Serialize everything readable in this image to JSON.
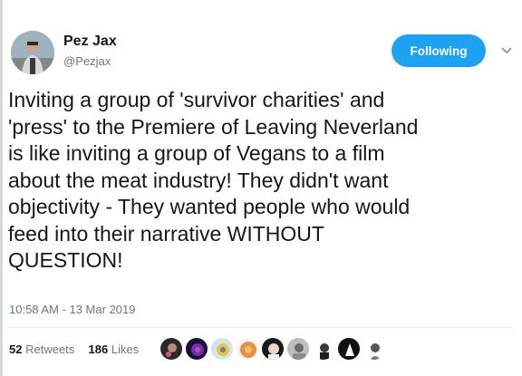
{
  "user": {
    "display_name": "Pez Jax",
    "handle": "@Pezjax"
  },
  "follow_button": {
    "label": "Following"
  },
  "tweet": {
    "text_lines": [
      "Inviting a group of 'survivor charities' and",
      "'press' to the Premiere of Leaving Neverland",
      "is like inviting a group of Vegans to a film",
      "about the meat industry! They didn't want",
      "objectivity - They wanted people who would",
      "feed into their narrative WITHOUT",
      "QUESTION!"
    ],
    "timestamp": "10:58 AM - 13 Mar 2019"
  },
  "stats": {
    "retweets_count": "52",
    "retweets_label": "Retweets",
    "likes_count": "186",
    "likes_label": "Likes"
  },
  "colors": {
    "accent": "#1da1f2",
    "text": "#14171a",
    "muted": "#657786"
  }
}
